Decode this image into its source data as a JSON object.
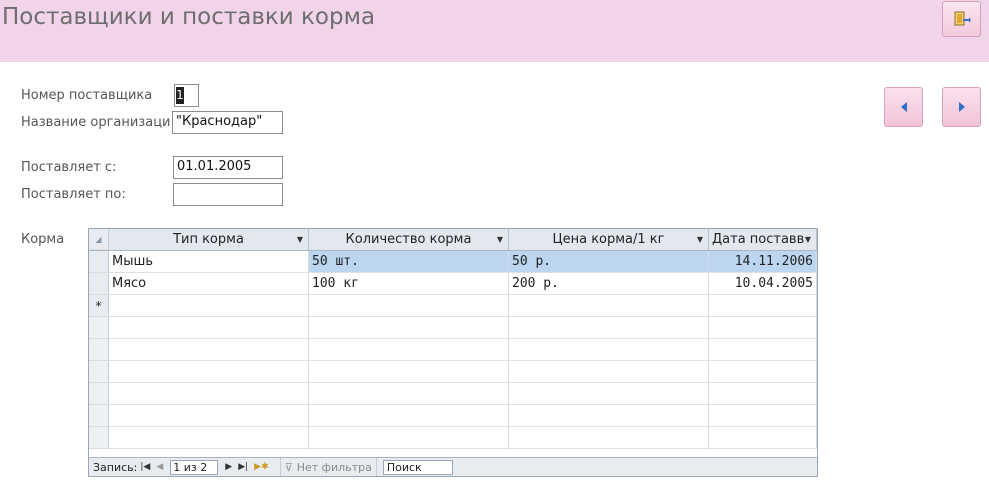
{
  "form": {
    "title": "Поставщики и поставки корма",
    "close_icon": "exit-door-icon",
    "nav_prev_icon": "triangle-left-icon",
    "nav_next_icon": "triangle-right-icon"
  },
  "fields": {
    "supplier_number_label": "Номер поставщика",
    "supplier_number_value": "1",
    "organization_label": "Название организаци",
    "organization_value": "\"Краснодар\"",
    "supplies_from_label": "Поставляет с:",
    "supplies_from_value": "01.01.2005",
    "supplies_to_label": "Поставляет по:",
    "supplies_to_value": ""
  },
  "subform": {
    "label": "Корма",
    "columns": [
      "Тип корма",
      "Количество корма",
      "Цена корма/1 кг",
      "Дата поставв"
    ],
    "rows": [
      [
        "Мышь",
        "50 шт.",
        "50 р.",
        "14.11.2006"
      ],
      [
        "Мясо",
        "100 кг",
        "200 р.",
        "10.04.2005"
      ]
    ],
    "new_row_marker": "*",
    "nav": {
      "record_label": "Запись:",
      "record_value": "1 из 2",
      "filter_label": "Нет фильтра",
      "search_placeholder": "Поиск"
    }
  },
  "colors": {
    "header_bg": "#f1d4ea",
    "selected_row": "#bcd6f2"
  }
}
